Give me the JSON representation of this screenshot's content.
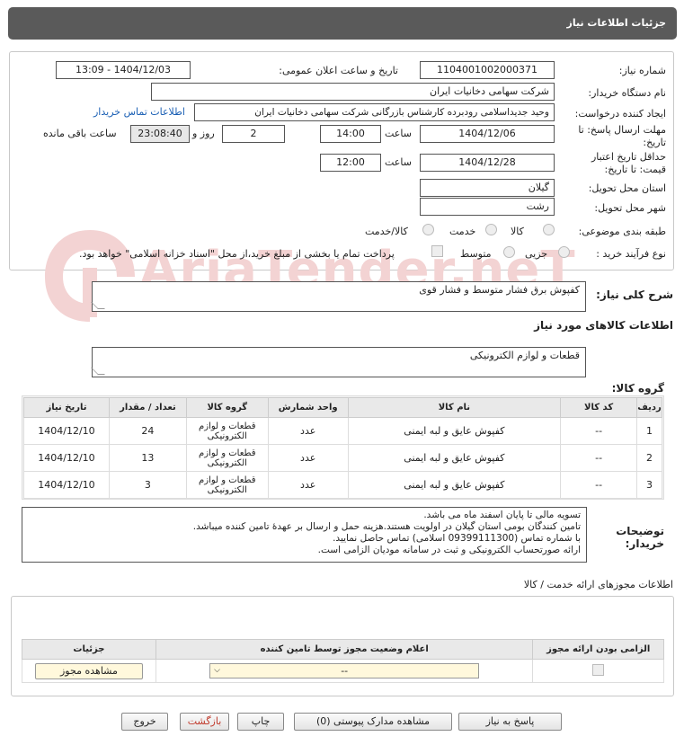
{
  "page": {
    "title": "جزئیات اطلاعات نیاز"
  },
  "form": {
    "need_number_label": "شماره نیاز:",
    "need_number": "1104001002000371",
    "announce_label": "تاریخ و ساعت اعلان عمومی:",
    "announce_value": "1404/12/03 - 13:09",
    "buyer_label": "نام دستگاه خریدار:",
    "buyer": "شرکت سهامی دخانیات ایران",
    "creator_label": "ایجاد کننده درخواست:",
    "creator": "وحید جدیداسلامی رودبرده کارشناس بازرگانی شرکت سهامی دخانیات ایران",
    "contact_link": "اطلاعات تماس خریدار",
    "deadline_label_1": "مهلت ارسال پاسخ: تا",
    "deadline_label_2": "تاریخ:",
    "deadline_date": "1404/12/06",
    "time_label": "ساعت",
    "deadline_time": "14:00",
    "days": "2",
    "days_label": "روز و",
    "remaining": "23:08:40",
    "remaining_label": "ساعت باقی مانده",
    "validity_label_1": "حداقل تاریخ اعتبار",
    "validity_label_2": "قیمت: تا تاریخ:",
    "validity_date": "1404/12/28",
    "validity_time": "12:00",
    "province_label": "استان محل تحویل:",
    "province": "گیلان",
    "city_label": "شهر محل تحویل:",
    "city": "رشت",
    "category_label": "طبقه بندی موضوعی:",
    "cat_goods": "کالا",
    "cat_service": "خدمت",
    "cat_both": "کالا/خدمت",
    "process_label": "نوع فرآیند خرید :",
    "proc_small": "جزیی",
    "proc_medium": "متوسط",
    "proc_note": "پرداخت تمام یا بخشی از مبلغ خرید،از محل \"اسناد خزانه اسلامی\" خواهد بود."
  },
  "summary": {
    "label": "شرح کلی نیاز:",
    "value": "کفپوش برق فشار متوسط و فشار قوی"
  },
  "goods_info_title": "اطلاعات کالاهای مورد نیاز",
  "goods_group": {
    "label": "گروه کالا:",
    "value": "قطعات و لوازم الکترونیکی"
  },
  "table": {
    "headers": [
      "ردیف",
      "کد کالا",
      "نام کالا",
      "واحد شمارش",
      "گروه کالا",
      "تعداد / مقدار",
      "تاریخ نیاز"
    ],
    "rows": [
      [
        "1",
        "--",
        "کفپوش عایق و لبه ایمنی",
        "عدد",
        "قطعات و لوازم الکترونیکی",
        "24",
        "1404/12/10"
      ],
      [
        "2",
        "--",
        "کفپوش عایق و لبه ایمنی",
        "عدد",
        "قطعات و لوازم الکترونیکی",
        "13",
        "1404/12/10"
      ],
      [
        "3",
        "--",
        "کفپوش عایق و لبه ایمنی",
        "عدد",
        "قطعات و لوازم الکترونیکی",
        "3",
        "1404/12/10"
      ]
    ]
  },
  "buyer_notes": {
    "label_1": "توضیحات",
    "label_2": "خریدار:",
    "lines": [
      "تسویه مالی تا پایان اسفند ماه می باشد.",
      "تامین کنندگان بومی استان گیلان در اولویت هستند.هزینه حمل و ارسال بر عهدهٔ تامین کننده میباشد.",
      "با شماره تماس (09399111300 اسلامی) تماس حاصل نمایید.",
      "ارائه صورتحساب الکترونیکی و ثبت در سامانه مودیان الزامی است."
    ]
  },
  "permits": {
    "title": "اطلاعات مجوزهای ارائه خدمت / کالا",
    "headers": [
      "الزامی بودن ارائه مجوز",
      "اعلام وضعیت مجوز توسط تامین کننده",
      "جزئیات"
    ],
    "select_value": "--",
    "view_button": "مشاهده مجوز"
  },
  "buttons": {
    "reply": "پاسخ به نیاز",
    "attachments": "مشاهده مدارک پیوستی (0)",
    "print": "چاپ",
    "back": "بازگشت",
    "exit": "خروج"
  },
  "colors": {
    "header_bg": "#5a5a5a",
    "link": "#1a5fb4",
    "back_text": "#c0392b"
  }
}
